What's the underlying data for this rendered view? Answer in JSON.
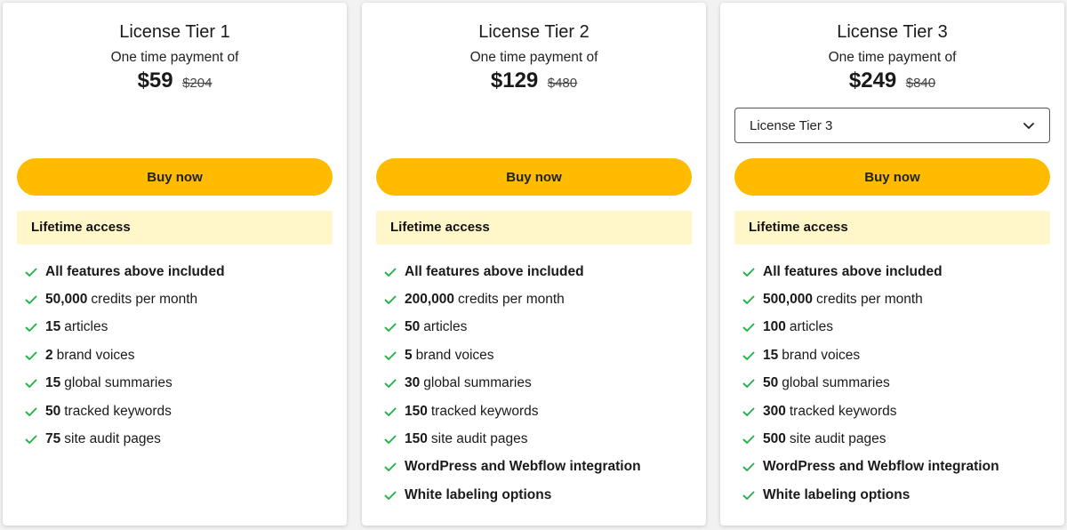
{
  "colors": {
    "accent_button": "#ffbb00",
    "access_banner": "#fff7c9",
    "check": "#22b34a",
    "background": "#f2f2f2"
  },
  "icons": {
    "feature": "check-icon",
    "dropdown": "chevron-down-icon"
  },
  "tiers": [
    {
      "title": "License Tier 1",
      "subtitle": "One time payment of",
      "price": "$59",
      "old_price": "$204",
      "buy_label": "Buy now",
      "access_label": "Lifetime access",
      "features": [
        {
          "bold": "All features above included",
          "text": ""
        },
        {
          "bold": "50,000",
          "text": "credits per month"
        },
        {
          "bold": "15",
          "text": "articles"
        },
        {
          "bold": "2",
          "text": "brand voices"
        },
        {
          "bold": "15",
          "text": "global summaries"
        },
        {
          "bold": "50",
          "text": "tracked keywords"
        },
        {
          "bold": "75",
          "text": "site audit pages"
        }
      ]
    },
    {
      "title": "License Tier 2",
      "subtitle": "One time payment of",
      "price": "$129",
      "old_price": "$480",
      "buy_label": "Buy now",
      "access_label": "Lifetime access",
      "features": [
        {
          "bold": "All features above included",
          "text": ""
        },
        {
          "bold": "200,000",
          "text": "credits per month"
        },
        {
          "bold": "50",
          "text": "articles"
        },
        {
          "bold": "5",
          "text": "brand voices"
        },
        {
          "bold": "30",
          "text": "global summaries"
        },
        {
          "bold": "150",
          "text": "tracked keywords"
        },
        {
          "bold": "150",
          "text": "site audit pages"
        },
        {
          "bold": "WordPress and Webflow integration",
          "text": ""
        },
        {
          "bold": "White labeling options",
          "text": ""
        }
      ]
    },
    {
      "title": "License Tier 3",
      "subtitle": "One time payment of",
      "price": "$249",
      "old_price": "$840",
      "select_value": "License Tier 3",
      "buy_label": "Buy now",
      "access_label": "Lifetime access",
      "features": [
        {
          "bold": "All features above included",
          "text": ""
        },
        {
          "bold": "500,000",
          "text": "credits per month"
        },
        {
          "bold": "100",
          "text": "articles"
        },
        {
          "bold": "15",
          "text": "brand voices"
        },
        {
          "bold": "50",
          "text": "global summaries"
        },
        {
          "bold": "300",
          "text": "tracked keywords"
        },
        {
          "bold": "500",
          "text": "site audit pages"
        },
        {
          "bold": "WordPress and Webflow integration",
          "text": ""
        },
        {
          "bold": "White labeling options",
          "text": ""
        }
      ]
    }
  ]
}
